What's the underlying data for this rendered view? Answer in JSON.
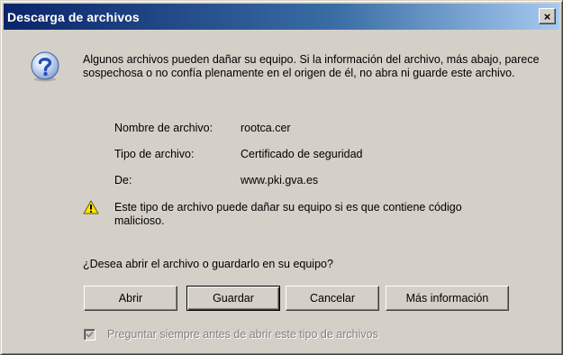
{
  "window": {
    "title": "Descarga de archivos",
    "close_glyph": "×"
  },
  "message": "Algunos archivos pueden dañar su equipo. Si la información del archivo, más abajo, parece sospechosa o no confía plenamente en el origen de él, no abra ni guarde este archivo.",
  "file_info": [
    {
      "label": "Nombre de archivo:",
      "value": "rootca.cer"
    },
    {
      "label": "Tipo de archivo:",
      "value": "Certificado de seguridad"
    },
    {
      "label": "De:",
      "value": "www.pki.gva.es"
    }
  ],
  "warning": "Este tipo de archivo puede dañar su equipo si es que contiene código malicioso.",
  "question": "¿Desea abrir el archivo o guardarlo en su equipo?",
  "buttons": {
    "open": "Abrir",
    "save": "Guardar",
    "cancel": "Cancelar",
    "more_info": "Más información"
  },
  "checkbox": {
    "label": "Preguntar siempre antes de abrir este tipo de archivos",
    "checked": true,
    "disabled": true
  },
  "icons": {
    "question": "question-icon",
    "warning": "warning-icon",
    "check": "checkmark-icon"
  },
  "colors": {
    "face": "#d4d0c8",
    "title_start": "#0a246a",
    "title_end": "#a6caf0",
    "warning_yellow": "#ffe400",
    "question_blue": "#2c5fc7"
  }
}
